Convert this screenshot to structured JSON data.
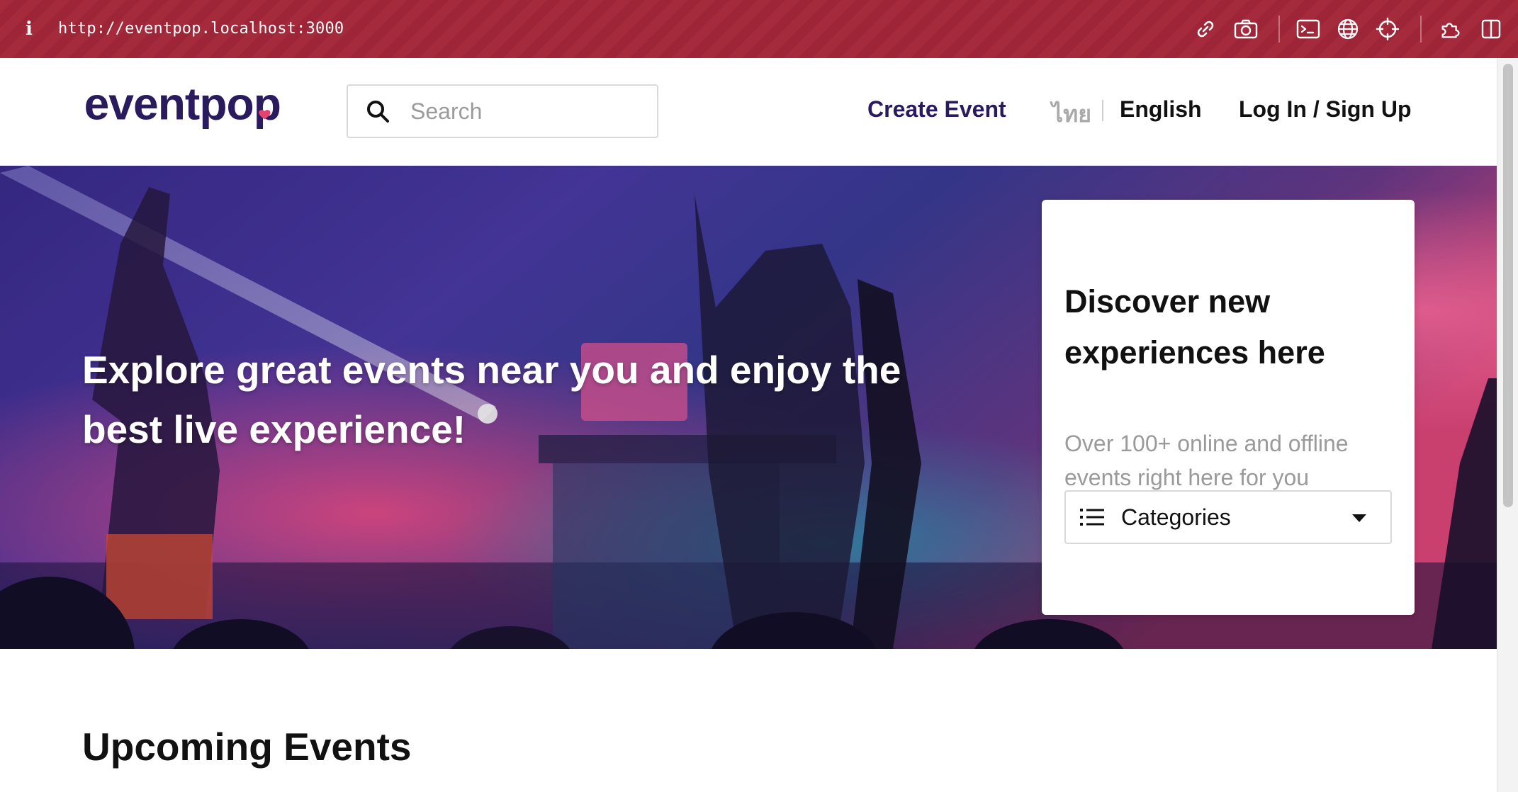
{
  "browser": {
    "info_glyph": "i",
    "url": "http://eventpop.localhost:3000",
    "toolbar_icons": [
      "link-icon",
      "camera-icon",
      "terminal-icon",
      "globe-icon",
      "crosshair-icon",
      "extensions-icon",
      "sidebar-icon"
    ]
  },
  "header": {
    "logo_text": "eventpop",
    "search": {
      "placeholder": "Search",
      "value": ""
    },
    "nav": {
      "create_event": "Create Event",
      "lang_thai": "ไทย",
      "lang_english": "English",
      "login": "Log In / Sign Up"
    }
  },
  "hero": {
    "title": "Explore great events near you and enjoy the best live experience!",
    "card": {
      "title": "Discover new experiences here",
      "subtitle": "Over 100+ online and offline events right here for you",
      "categories_label": "Categories"
    }
  },
  "sections": {
    "upcoming_title": "Upcoming Events"
  },
  "colors": {
    "chrome_bg": "#a52a3c",
    "brand_navy": "#2a1a5e",
    "brand_heart": "#e5426f",
    "muted_text": "#9a9a9a"
  }
}
